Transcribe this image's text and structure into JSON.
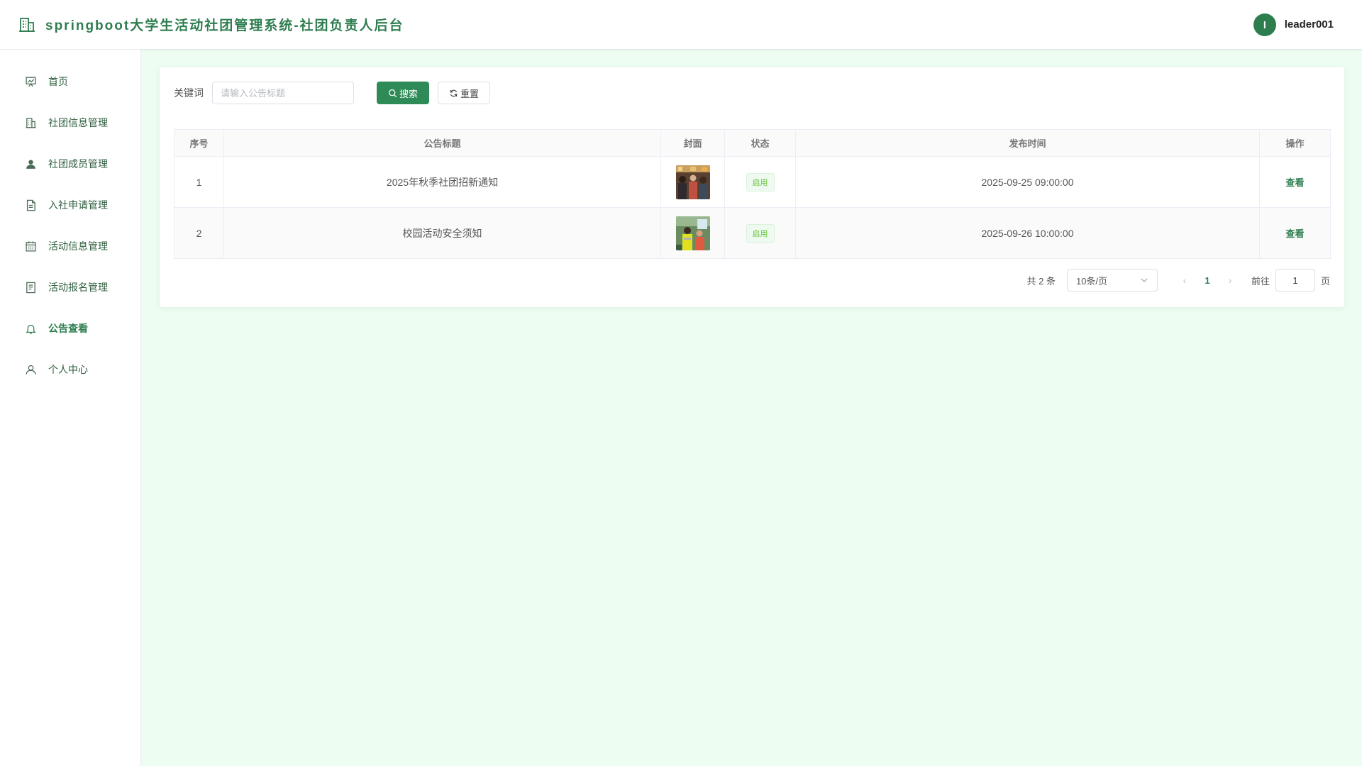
{
  "header": {
    "title": "springboot大学生活动社团管理系统-社团负责人后台",
    "avatar_letter": "l",
    "username": "leader001"
  },
  "sidebar": {
    "items": [
      {
        "label": "首页",
        "icon": "home-icon"
      },
      {
        "label": "社团信息管理",
        "icon": "building-icon"
      },
      {
        "label": "社团成员管理",
        "icon": "user-icon"
      },
      {
        "label": "入社申请管理",
        "icon": "document-icon"
      },
      {
        "label": "活动信息管理",
        "icon": "calendar-icon"
      },
      {
        "label": "活动报名管理",
        "icon": "list-icon"
      },
      {
        "label": "公告查看",
        "icon": "bell-icon",
        "active": true
      },
      {
        "label": "个人中心",
        "icon": "person-icon"
      }
    ]
  },
  "search": {
    "label": "关键词",
    "placeholder": "请输入公告标题",
    "value": "",
    "search_button": "搜索",
    "reset_button": "重置"
  },
  "table": {
    "columns": [
      "序号",
      "公告标题",
      "封面",
      "状态",
      "发布时间",
      "操作"
    ],
    "rows": [
      {
        "index": "1",
        "title": "2025年秋季社团招新通知",
        "status": "启用",
        "publish_time": "2025-09-25 09:00:00",
        "action": "查看"
      },
      {
        "index": "2",
        "title": "校园活动安全须知",
        "status": "启用",
        "publish_time": "2025-09-26 10:00:00",
        "action": "查看"
      }
    ]
  },
  "pagination": {
    "total_text": "共 2 条",
    "page_size": "10条/页",
    "current_page": "1",
    "goto_label": "前往",
    "goto_value": "1",
    "goto_suffix": "页"
  },
  "colors": {
    "accent": "#2e7d4f",
    "background": "#edfdf2",
    "tag_green": "#67c23a"
  }
}
